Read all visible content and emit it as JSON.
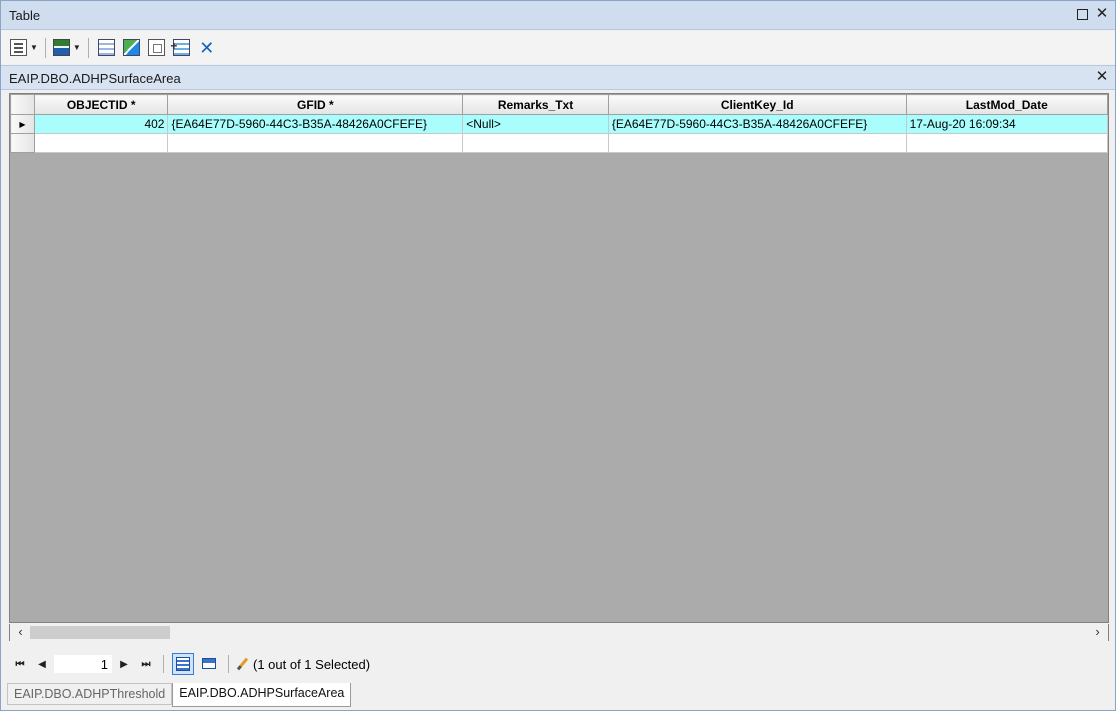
{
  "window": {
    "title": "Table"
  },
  "toolbar": {
    "icons": [
      "table-options-icon",
      "related-tables-icon",
      "select-by-attributes-icon",
      "switch-selection-icon",
      "clear-selection-icon",
      "delete-selected-icon",
      "delete-icon"
    ],
    "delete_glyph": "✕"
  },
  "table": {
    "name": "EAIP.DBO.ADHPSurfaceArea",
    "columns": [
      "OBJECTID *",
      "GFID *",
      "Remarks_Txt",
      "ClientKey_Id",
      "LastMod_Date"
    ],
    "rows": [
      [
        "402",
        "{EA64E77D-5960-44C3-B35A-48426A0CFEFE}",
        "<Null>",
        "{EA64E77D-5960-44C3-B35A-48426A0CFEFE}",
        "17-Aug-20 16:09:34"
      ]
    ],
    "selected_row_marker": "▶"
  },
  "navigation": {
    "current_record": "1",
    "status": "(1 out of 1 Selected)"
  },
  "tabs": [
    {
      "label": "EAIP.DBO.ADHPThreshold",
      "active": false
    },
    {
      "label": "EAIP.DBO.ADHPSurfaceArea",
      "active": true
    }
  ],
  "colors": {
    "selected_row": "#a9fdfd",
    "title_bar": "#cfddee"
  }
}
